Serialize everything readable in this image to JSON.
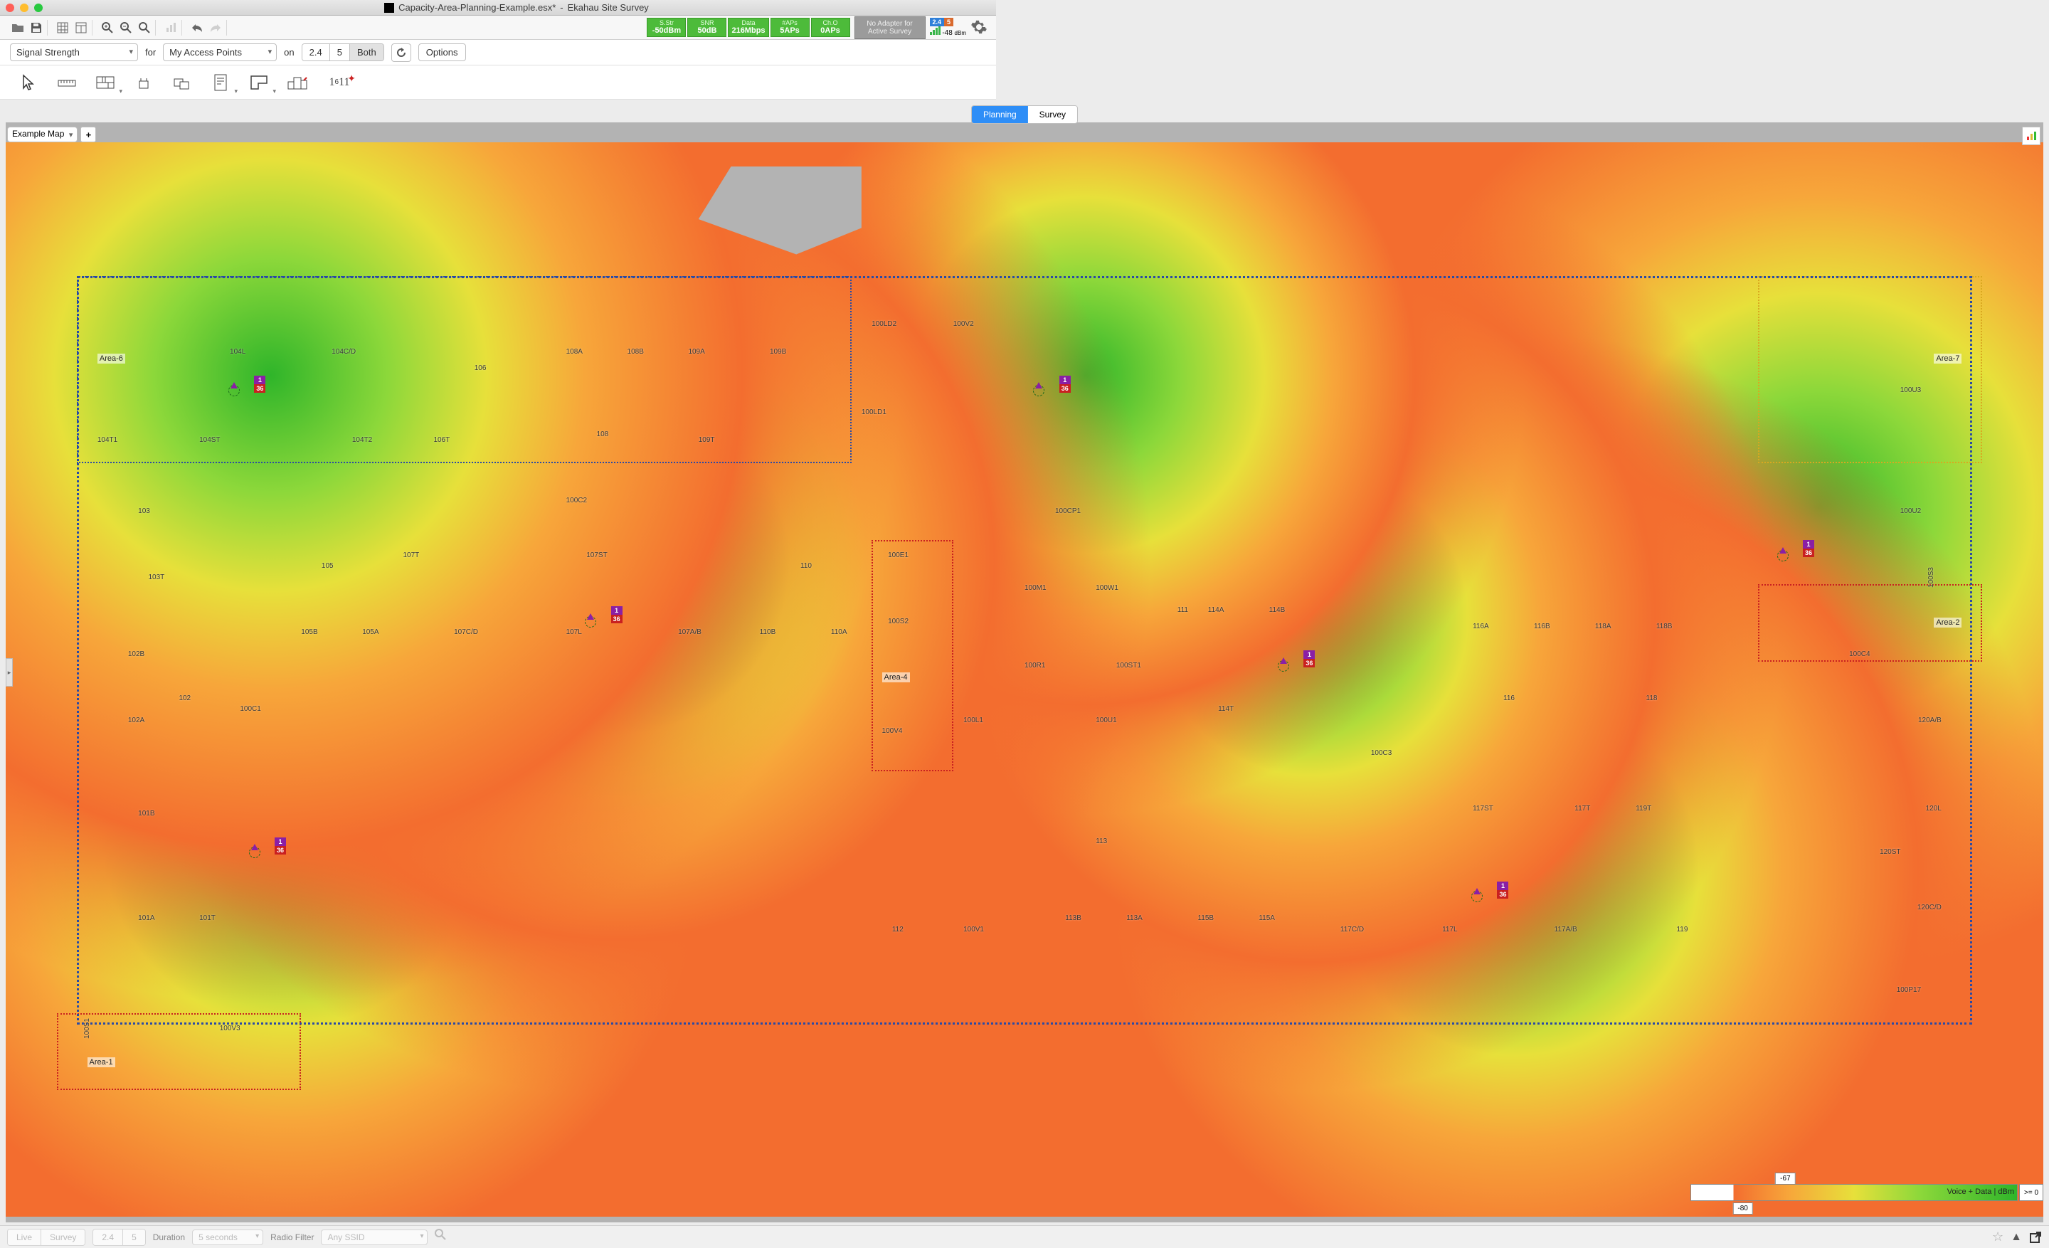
{
  "window": {
    "filename": "Capacity-Area-Planning-Example.esx*",
    "appname": "Ekahau Site Survey"
  },
  "status": {
    "sstr": {
      "h": "S.Str",
      "v": "-50dBm"
    },
    "snr": {
      "h": "SNR",
      "v": "50dB"
    },
    "data": {
      "h": "Data",
      "v": "216Mbps"
    },
    "aps": {
      "h": "#APs",
      "v": "5APs"
    },
    "cho": {
      "h": "Ch.O",
      "v": "0APs"
    },
    "adapter": "No Adapter for Active Survey",
    "band24": "2.4",
    "band5": "5",
    "dbm": "-48",
    "dbm_unit": "dBm"
  },
  "filter": {
    "viz": "Signal Strength",
    "for": "for",
    "aps": "My Access Points",
    "on": "on",
    "b24": "2.4",
    "b5": "5",
    "both": "Both",
    "options": "Options"
  },
  "mode": {
    "planning": "Planning",
    "survey": "Survey"
  },
  "mapselect": {
    "name": "Example Map",
    "add": "+"
  },
  "areas": {
    "a1": "Area-1",
    "a2": "Area-2",
    "a4": "Area-4",
    "a6": "Area-6",
    "a7": "Area-7"
  },
  "ap_ch": {
    "c1": "1",
    "c2": "36"
  },
  "rooms": {
    "r104L": "104L",
    "r104CD": "104C/D",
    "r106": "106",
    "r108A": "108A",
    "r108B": "108B",
    "r109A": "109A",
    "r109B": "109B",
    "r100LD2": "100LD2",
    "r100V2": "100V2",
    "r100LD1": "100LD1",
    "r100CP1": "100CP1",
    "r100M1": "100M1",
    "r100W1": "100W1",
    "r104T1": "104T1",
    "r104ST": "104ST",
    "r104T2": "104T2",
    "r106T": "106T",
    "r108": "108",
    "r109T": "109T",
    "r103": "103",
    "r100C2": "100C2",
    "r111": "111",
    "r114A": "114A",
    "r114B": "114B",
    "r116A": "116A",
    "r116B": "116B",
    "r118A": "118A",
    "r118B": "118B",
    "r103T": "103T",
    "r105": "105",
    "r107T": "107T",
    "r107ST": "107ST",
    "r109": "109T",
    "r110": "110",
    "r100R1": "100R1",
    "r100ST1": "100ST1",
    "r114T": "114T",
    "r116": "116",
    "r118": "118",
    "r102B": "102B",
    "r105B": "105B",
    "r105A": "105A",
    "r107CD": "107C/D",
    "r107L": "107L",
    "r107AB": "107A/B",
    "r110B": "110B",
    "r110A": "110A",
    "r102": "102",
    "r100C1": "100C1",
    "r100V4": "100V4",
    "r100L1": "100L1",
    "r100U1": "100U1",
    "r100C3": "100C3",
    "r102A": "102A",
    "r112": "112",
    "r100V1": "100V1",
    "r113": "113",
    "r117ST": "117ST",
    "r117T": "117T",
    "r119T": "119T",
    "r101B": "101B",
    "r113B": "113B",
    "r113A": "113A",
    "r115B": "115B",
    "r115A": "115A",
    "r117CD": "117C/D",
    "r117L": "117L",
    "r117AB": "117A/B",
    "r119": "119",
    "r101A": "101A",
    "r101T": "101T",
    "r100S1": "100S1",
    "r100V3": "100V3",
    "r100U3": "100U3",
    "r100U2": "100U2",
    "r100C4": "100C4",
    "r100S3": "100S3",
    "r120AB": "120A/B",
    "r120L": "120L",
    "r120ST": "120ST",
    "r120CD": "120C/D",
    "r100P17": "100P17",
    "r100E1": "100E1",
    "r100S2": "100S2"
  },
  "legend": {
    "m67": "-67",
    "m80": "-80",
    "title": "Voice + Data | dBm",
    "ge0": ">= 0"
  },
  "bottom": {
    "live": "Live",
    "survey": "Survey",
    "b24": "2.4",
    "b5": "5",
    "duration": "Duration",
    "durval": "5 seconds",
    "radiofilter": "Radio Filter",
    "anyssid": "Any SSID"
  }
}
